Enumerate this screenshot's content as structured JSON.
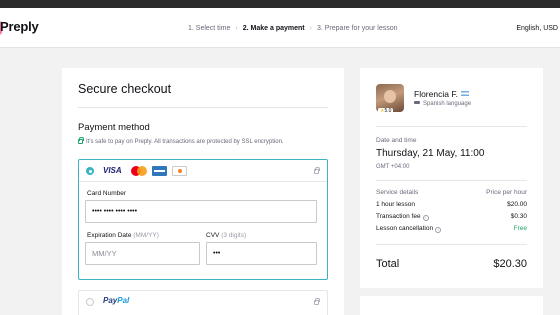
{
  "header": {
    "logo": "Preply",
    "steps": [
      "1. Select time",
      "2. Make a payment",
      "3. Prepare for your lesson"
    ],
    "current_step": 1,
    "locale": "English, USD"
  },
  "checkout": {
    "title": "Secure checkout",
    "payment_method_title": "Payment method",
    "safe_note": "It's safe to pay on Preply. All transactions are protected by SSL encryption.",
    "card": {
      "brands": [
        "VISA",
        "Mastercard",
        "American Express",
        "Discover"
      ],
      "visa_label": "VISA",
      "number_label": "Card Number",
      "number_value": "•••• •••• •••• ••••",
      "exp_label": "Expiration Date",
      "exp_hint": "(MM/YY)",
      "exp_placeholder": "MM/YY",
      "cvv_label": "CVV",
      "cvv_hint": "(3 digits)",
      "cvv_value": "•••"
    },
    "paypal": {
      "label_a": "Pay",
      "label_b": "Pal"
    }
  },
  "summary": {
    "tutor_name": "Florencia F.",
    "subject": "Spanish language",
    "rating": "5.0",
    "date_label": "Date and time",
    "date_value": "Thursday, 21 May, 11:00",
    "timezone": "GMT +04:00",
    "details_label": "Service details",
    "price_label": "Price per hour",
    "lines": [
      {
        "label": "1 hour lesson",
        "value": "$20.00"
      },
      {
        "label": "Transaction fee",
        "value": "$0.30"
      },
      {
        "label": "Lesson cancellation",
        "value": "Free"
      }
    ],
    "total_label": "Total",
    "total_value": "$20.30"
  },
  "colors": {
    "accent": "#3bb3c3",
    "success": "#21a56a",
    "brand_pink": "#ff7aac"
  }
}
